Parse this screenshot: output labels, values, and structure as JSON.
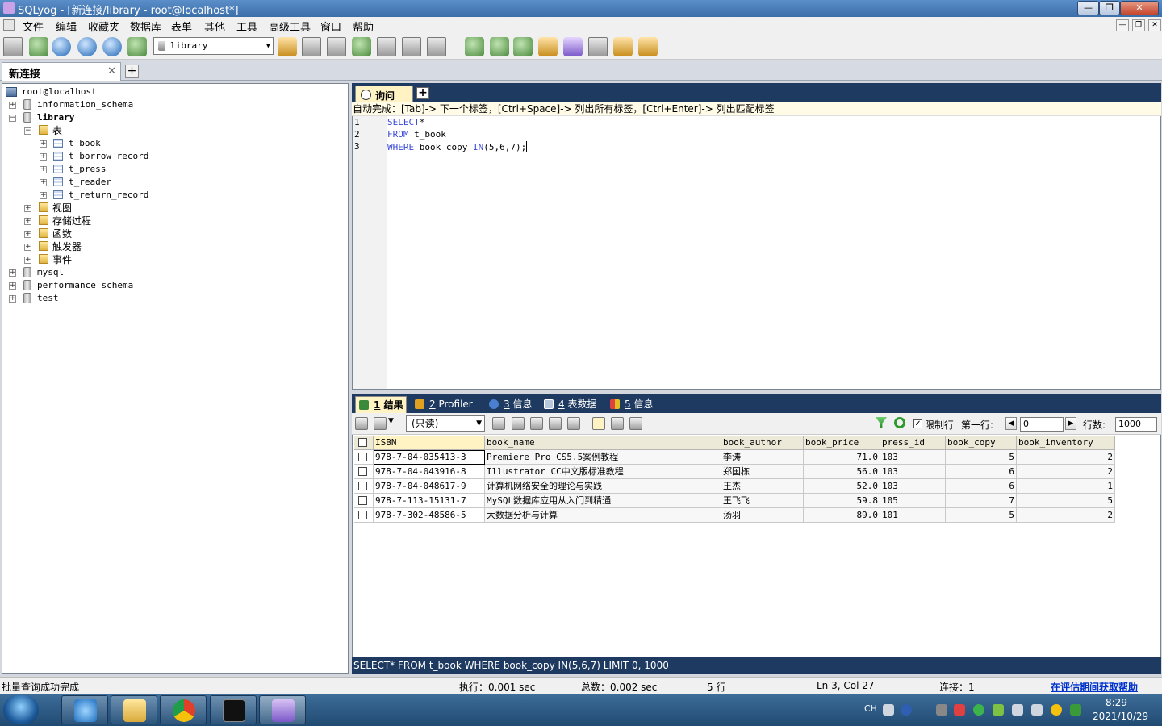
{
  "window": {
    "title": "SQLyog - [新连接/library - root@localhost*]",
    "minimize": "—",
    "maximize": "❐",
    "close": "✕"
  },
  "menu": [
    "文件",
    "编辑",
    "收藏夹",
    "数据库",
    "表单",
    "其他",
    "工具",
    "高级工具",
    "窗口",
    "帮助"
  ],
  "toolbar": {
    "database_select": "library"
  },
  "connection_tab": {
    "label": "新连接",
    "close": "✕",
    "add": "+"
  },
  "tree": {
    "root": "root@localhost",
    "nodes": [
      {
        "label": "information_schema",
        "expander": "+"
      },
      {
        "label": "library",
        "expander": "−"
      },
      {
        "label": "表",
        "expander": "−"
      },
      {
        "label": "t_book",
        "expander": "+"
      },
      {
        "label": "t_borrow_record",
        "expander": "+"
      },
      {
        "label": "t_press",
        "expander": "+"
      },
      {
        "label": "t_reader",
        "expander": "+"
      },
      {
        "label": "t_return_record",
        "expander": "+"
      },
      {
        "label": "视图",
        "expander": "+"
      },
      {
        "label": "存储过程",
        "expander": "+"
      },
      {
        "label": "函数",
        "expander": "+"
      },
      {
        "label": "触发器",
        "expander": "+"
      },
      {
        "label": "事件",
        "expander": "+"
      },
      {
        "label": "mysql",
        "expander": "+"
      },
      {
        "label": "performance_schema",
        "expander": "+"
      },
      {
        "label": "test",
        "expander": "+"
      }
    ]
  },
  "query_tab": {
    "label": "询问",
    "add": "+"
  },
  "autocomplete_hint": "自动完成：[Tab]-> 下一个标签，[Ctrl+Space]-> 列出所有标签，[Ctrl+Enter]-> 列出匹配标签",
  "editor": {
    "lines": [
      {
        "no": "1",
        "kw": "SELECT",
        "rest": "*"
      },
      {
        "no": "2",
        "kw": "FROM",
        "rest": " t_book"
      },
      {
        "no": "3",
        "kw": "WHERE",
        "mid": " book_copy ",
        "kw2": "IN",
        "rest": "(5,6,7);"
      }
    ]
  },
  "result_tabs": [
    {
      "num": "1",
      "label": "结果"
    },
    {
      "num": "2",
      "label": "Profiler"
    },
    {
      "num": "3",
      "label": "信息"
    },
    {
      "num": "4",
      "label": "表数据"
    },
    {
      "num": "5",
      "label": "信息"
    }
  ],
  "result_toolbar": {
    "readonly": "(只读)",
    "limit_label": "限制行",
    "limit_checked": "✓",
    "first_row_label": "第一行:",
    "first_row_value": "0",
    "rows_label": "行数:",
    "rows_value": "1000"
  },
  "grid": {
    "columns": [
      "ISBN",
      "book_name",
      "book_author",
      "book_price",
      "press_id",
      "book_copy",
      "book_inventory"
    ],
    "rows": [
      [
        "978-7-04-035413-3",
        "Premiere Pro CS5.5案例教程",
        "李涛",
        "71.0",
        "103",
        "5",
        "2"
      ],
      [
        "978-7-04-043916-8",
        "Illustrator CC中文版标准教程",
        "郑国栋",
        "56.0",
        "103",
        "6",
        "2"
      ],
      [
        "978-7-04-048617-9",
        "计算机网络安全的理论与实践",
        "王杰",
        "52.0",
        "103",
        "6",
        "1"
      ],
      [
        "978-7-113-15131-7",
        "MySQL数据库应用从入门到精通",
        "王飞飞",
        "59.8",
        "105",
        "7",
        "5"
      ],
      [
        "978-7-302-48586-5",
        "大数据分析与计算",
        "汤羽",
        "89.0",
        "101",
        "5",
        "2"
      ]
    ]
  },
  "sql_status": "SELECT* FROM t_book WHERE book_copy IN(5,6,7) LIMIT 0, 1000",
  "statusbar": {
    "message": "批量查询成功完成",
    "exec": "执行：0.001 sec",
    "total": "总数：0.002 sec",
    "rows": "5 行",
    "cursor": "Ln 3, Col 27",
    "connections": "连接：1",
    "help": "在评估期间获取帮助"
  },
  "taskbar": {
    "lang": "CH",
    "time": "8:29",
    "date": "2021/10/29"
  }
}
